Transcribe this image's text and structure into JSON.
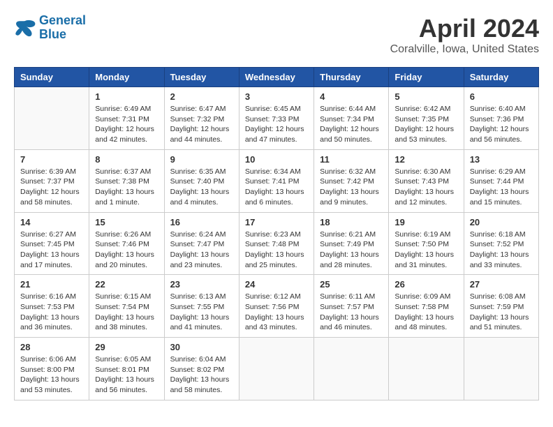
{
  "logo": {
    "line1": "General",
    "line2": "Blue"
  },
  "title": "April 2024",
  "subtitle": "Coralville, Iowa, United States",
  "days_header": [
    "Sunday",
    "Monday",
    "Tuesday",
    "Wednesday",
    "Thursday",
    "Friday",
    "Saturday"
  ],
  "weeks": [
    [
      {
        "day": "",
        "info": ""
      },
      {
        "day": "1",
        "info": "Sunrise: 6:49 AM\nSunset: 7:31 PM\nDaylight: 12 hours\nand 42 minutes."
      },
      {
        "day": "2",
        "info": "Sunrise: 6:47 AM\nSunset: 7:32 PM\nDaylight: 12 hours\nand 44 minutes."
      },
      {
        "day": "3",
        "info": "Sunrise: 6:45 AM\nSunset: 7:33 PM\nDaylight: 12 hours\nand 47 minutes."
      },
      {
        "day": "4",
        "info": "Sunrise: 6:44 AM\nSunset: 7:34 PM\nDaylight: 12 hours\nand 50 minutes."
      },
      {
        "day": "5",
        "info": "Sunrise: 6:42 AM\nSunset: 7:35 PM\nDaylight: 12 hours\nand 53 minutes."
      },
      {
        "day": "6",
        "info": "Sunrise: 6:40 AM\nSunset: 7:36 PM\nDaylight: 12 hours\nand 56 minutes."
      }
    ],
    [
      {
        "day": "7",
        "info": "Sunrise: 6:39 AM\nSunset: 7:37 PM\nDaylight: 12 hours\nand 58 minutes."
      },
      {
        "day": "8",
        "info": "Sunrise: 6:37 AM\nSunset: 7:38 PM\nDaylight: 13 hours\nand 1 minute."
      },
      {
        "day": "9",
        "info": "Sunrise: 6:35 AM\nSunset: 7:40 PM\nDaylight: 13 hours\nand 4 minutes."
      },
      {
        "day": "10",
        "info": "Sunrise: 6:34 AM\nSunset: 7:41 PM\nDaylight: 13 hours\nand 6 minutes."
      },
      {
        "day": "11",
        "info": "Sunrise: 6:32 AM\nSunset: 7:42 PM\nDaylight: 13 hours\nand 9 minutes."
      },
      {
        "day": "12",
        "info": "Sunrise: 6:30 AM\nSunset: 7:43 PM\nDaylight: 13 hours\nand 12 minutes."
      },
      {
        "day": "13",
        "info": "Sunrise: 6:29 AM\nSunset: 7:44 PM\nDaylight: 13 hours\nand 15 minutes."
      }
    ],
    [
      {
        "day": "14",
        "info": "Sunrise: 6:27 AM\nSunset: 7:45 PM\nDaylight: 13 hours\nand 17 minutes."
      },
      {
        "day": "15",
        "info": "Sunrise: 6:26 AM\nSunset: 7:46 PM\nDaylight: 13 hours\nand 20 minutes."
      },
      {
        "day": "16",
        "info": "Sunrise: 6:24 AM\nSunset: 7:47 PM\nDaylight: 13 hours\nand 23 minutes."
      },
      {
        "day": "17",
        "info": "Sunrise: 6:23 AM\nSunset: 7:48 PM\nDaylight: 13 hours\nand 25 minutes."
      },
      {
        "day": "18",
        "info": "Sunrise: 6:21 AM\nSunset: 7:49 PM\nDaylight: 13 hours\nand 28 minutes."
      },
      {
        "day": "19",
        "info": "Sunrise: 6:19 AM\nSunset: 7:50 PM\nDaylight: 13 hours\nand 31 minutes."
      },
      {
        "day": "20",
        "info": "Sunrise: 6:18 AM\nSunset: 7:52 PM\nDaylight: 13 hours\nand 33 minutes."
      }
    ],
    [
      {
        "day": "21",
        "info": "Sunrise: 6:16 AM\nSunset: 7:53 PM\nDaylight: 13 hours\nand 36 minutes."
      },
      {
        "day": "22",
        "info": "Sunrise: 6:15 AM\nSunset: 7:54 PM\nDaylight: 13 hours\nand 38 minutes."
      },
      {
        "day": "23",
        "info": "Sunrise: 6:13 AM\nSunset: 7:55 PM\nDaylight: 13 hours\nand 41 minutes."
      },
      {
        "day": "24",
        "info": "Sunrise: 6:12 AM\nSunset: 7:56 PM\nDaylight: 13 hours\nand 43 minutes."
      },
      {
        "day": "25",
        "info": "Sunrise: 6:11 AM\nSunset: 7:57 PM\nDaylight: 13 hours\nand 46 minutes."
      },
      {
        "day": "26",
        "info": "Sunrise: 6:09 AM\nSunset: 7:58 PM\nDaylight: 13 hours\nand 48 minutes."
      },
      {
        "day": "27",
        "info": "Sunrise: 6:08 AM\nSunset: 7:59 PM\nDaylight: 13 hours\nand 51 minutes."
      }
    ],
    [
      {
        "day": "28",
        "info": "Sunrise: 6:06 AM\nSunset: 8:00 PM\nDaylight: 13 hours\nand 53 minutes."
      },
      {
        "day": "29",
        "info": "Sunrise: 6:05 AM\nSunset: 8:01 PM\nDaylight: 13 hours\nand 56 minutes."
      },
      {
        "day": "30",
        "info": "Sunrise: 6:04 AM\nSunset: 8:02 PM\nDaylight: 13 hours\nand 58 minutes."
      },
      {
        "day": "",
        "info": ""
      },
      {
        "day": "",
        "info": ""
      },
      {
        "day": "",
        "info": ""
      },
      {
        "day": "",
        "info": ""
      }
    ]
  ]
}
